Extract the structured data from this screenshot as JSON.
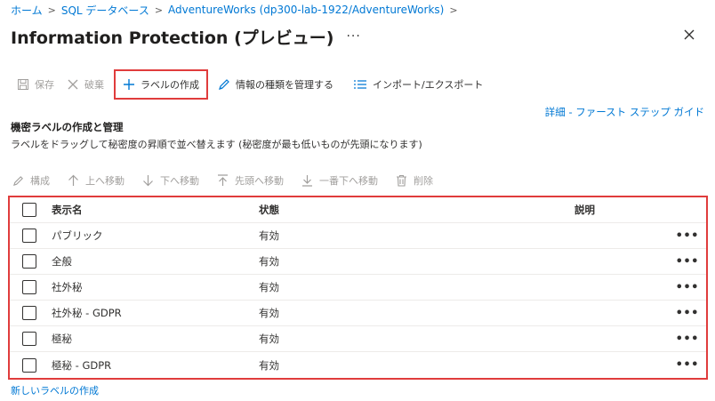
{
  "breadcrumb": [
    "ホーム",
    "SQL データベース",
    "AdventureWorks (dp300-lab-1922/AdventureWorks)"
  ],
  "header": {
    "title": "Information Protection (プレビュー)",
    "more": "···"
  },
  "toolbar": {
    "save": "保存",
    "discard": "破棄",
    "create_label": "ラベルの作成",
    "manage_info_types": "情報の種類を管理する",
    "import_export": "インポート/エクスポート"
  },
  "guide_link": "詳細 - ファースト ステップ ガイド",
  "section": {
    "title": "機密ラベルの作成と管理",
    "description": "ラベルをドラッグして秘密度の昇順で並べ替えます (秘密度が最も低いものが先頭になります)"
  },
  "subtoolbar": {
    "configure": "構成",
    "move_up": "上へ移動",
    "move_down": "下へ移動",
    "move_top": "先頭へ移動",
    "move_bottom": "一番下へ移動",
    "delete": "削除"
  },
  "table": {
    "headers": {
      "name": "表示名",
      "state": "状態",
      "description": "説明"
    },
    "rows": [
      {
        "name": "パブリック",
        "state": "有効",
        "description": ""
      },
      {
        "name": "全般",
        "state": "有効",
        "description": ""
      },
      {
        "name": "社外秘",
        "state": "有効",
        "description": ""
      },
      {
        "name": "社外秘 - GDPR",
        "state": "有効",
        "description": ""
      },
      {
        "name": "極秘",
        "state": "有効",
        "description": ""
      },
      {
        "name": "極秘 - GDPR",
        "state": "有効",
        "description": ""
      }
    ],
    "row_more": "•••"
  },
  "footer": {
    "new_label_link": "新しいラベルの作成"
  },
  "colors": {
    "accent": "#0078d4",
    "highlight_border": "#e03c3c",
    "disabled": "#a19f9d"
  }
}
